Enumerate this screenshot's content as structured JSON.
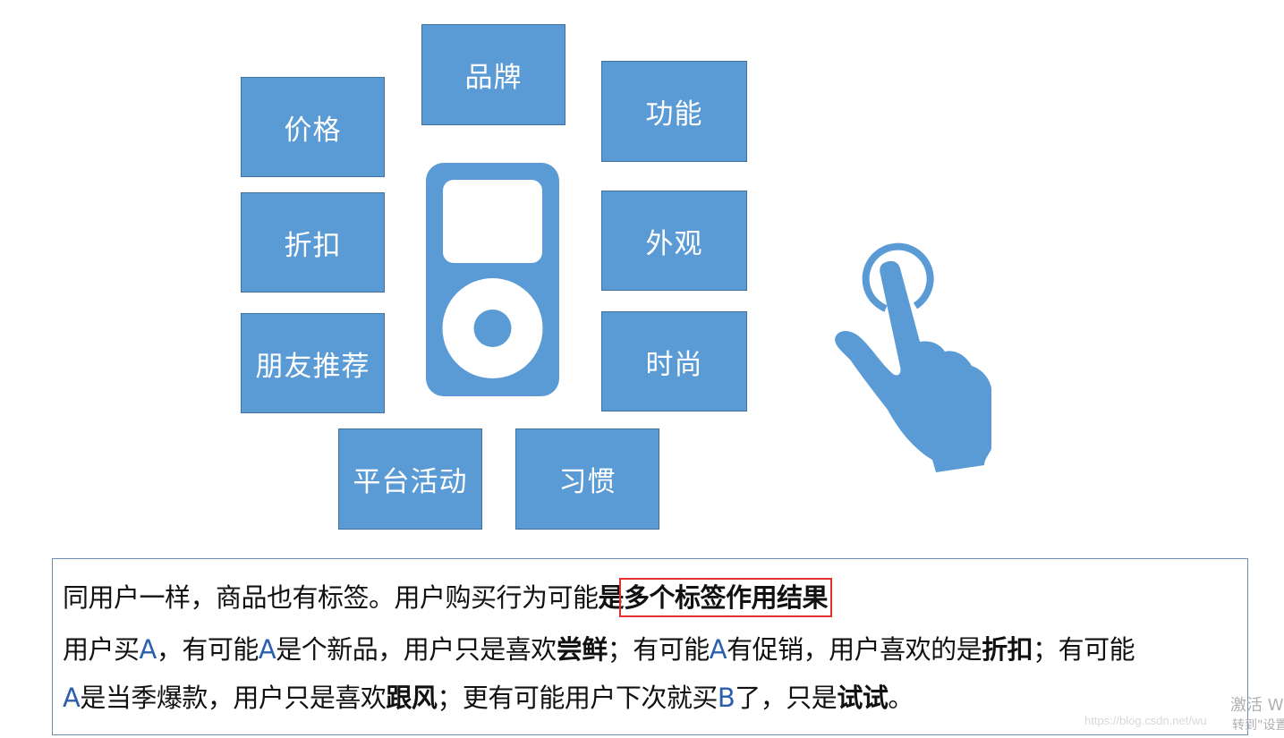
{
  "colors": {
    "tag_fill": "#5b9bd5",
    "tag_border": "#41719c",
    "icon_fill": "#5b9bd5",
    "highlight_box": "#e53030",
    "text_box_border": "#6d8fb5"
  },
  "tags": {
    "brand": "品牌",
    "price": "价格",
    "function": "功能",
    "discount": "折扣",
    "appearance": "外观",
    "friend_recommend": "朋友推荐",
    "fashion": "时尚",
    "platform_activity": "平台活动",
    "habit": "习惯"
  },
  "icons": {
    "product": "ipod-icon",
    "interaction": "hand-tap-icon"
  },
  "description": {
    "line1": {
      "plain": "同用户一样，商品也有标签。用户购买行为可能",
      "bold_is": "是",
      "highlighted": "多个标签作用结果"
    },
    "line2": {
      "p1": "用户买",
      "a1": "A",
      "p2": "，有可能",
      "a2": "A",
      "p3": "是个新品，用户只是喜欢",
      "b1": "尝鲜",
      "p4": "；有可能",
      "a3": "A",
      "p5": "有促销，用户喜欢的是",
      "b2": "折扣",
      "p6": "；有可能"
    },
    "line3": {
      "a4": "A",
      "p1": "是当季爆款，用户只是喜欢",
      "b1": "跟风",
      "p2": "；更有可能用户下次就买",
      "b_letter": "B",
      "p3": "了，只是",
      "b2": "试试",
      "p4": "。"
    }
  },
  "watermarks": {
    "activate": "激活 W",
    "url": "https://blog.csdn.net/wu",
    "settings": "转到\"设置"
  }
}
